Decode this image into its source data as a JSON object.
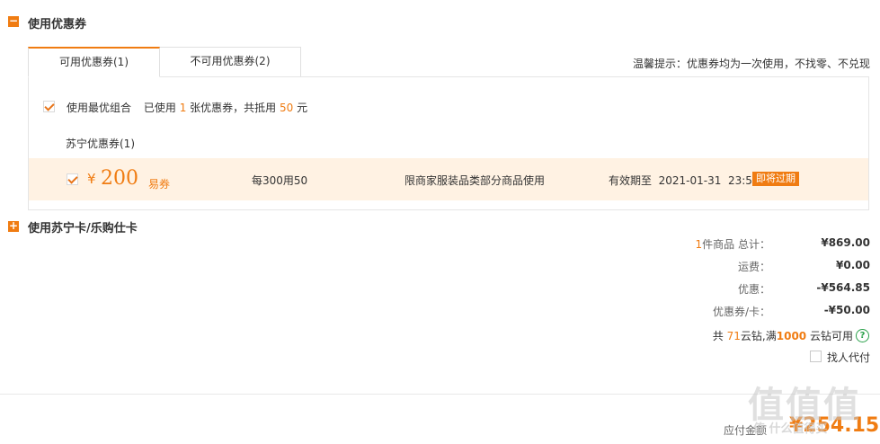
{
  "coupon_section": {
    "title": "使用优惠券",
    "tabs": [
      {
        "label": "可用优惠券(1)"
      },
      {
        "label": "不可用优惠券(2)"
      }
    ],
    "tip": "温馨提示：优惠券均为一次使用，不找零、不兑现",
    "best_combo": {
      "label": "使用最优组合",
      "used_prefix": "已使用",
      "used_count": "1",
      "used_mid": "张优惠券，共抵用",
      "amount": "50",
      "unit": "元"
    },
    "group_title": "苏宁优惠券(1)",
    "coupon": {
      "currency": "¥",
      "value": "200",
      "type": "易券",
      "rule": "每300用50",
      "scope": "限商家服装品类部分商品使用",
      "expiry": "有效期至  2021-01-31  23:59",
      "badge": "即将过期"
    }
  },
  "card_section": {
    "title": "使用苏宁卡/乐购仕卡"
  },
  "summary": {
    "items_count": "1",
    "items_label": "件商品 总计：",
    "items_total": "¥869.00",
    "shipping_label": "运费：",
    "shipping": "¥0.00",
    "discount_label": "优惠：",
    "discount": "-¥564.85",
    "coupon_label": "优惠券/卡：",
    "coupon": "-¥50.00",
    "cloud_prefix": "共",
    "cloud_count": "71",
    "cloud_mid": "云钻,满",
    "cloud_threshold": "1000",
    "cloud_suffix": "云钻可用",
    "proxy_pay": "找人代付"
  },
  "footer": {
    "payable_label": "应付金额",
    "payable": "¥254.15"
  },
  "watermark": "值 什么值得买"
}
